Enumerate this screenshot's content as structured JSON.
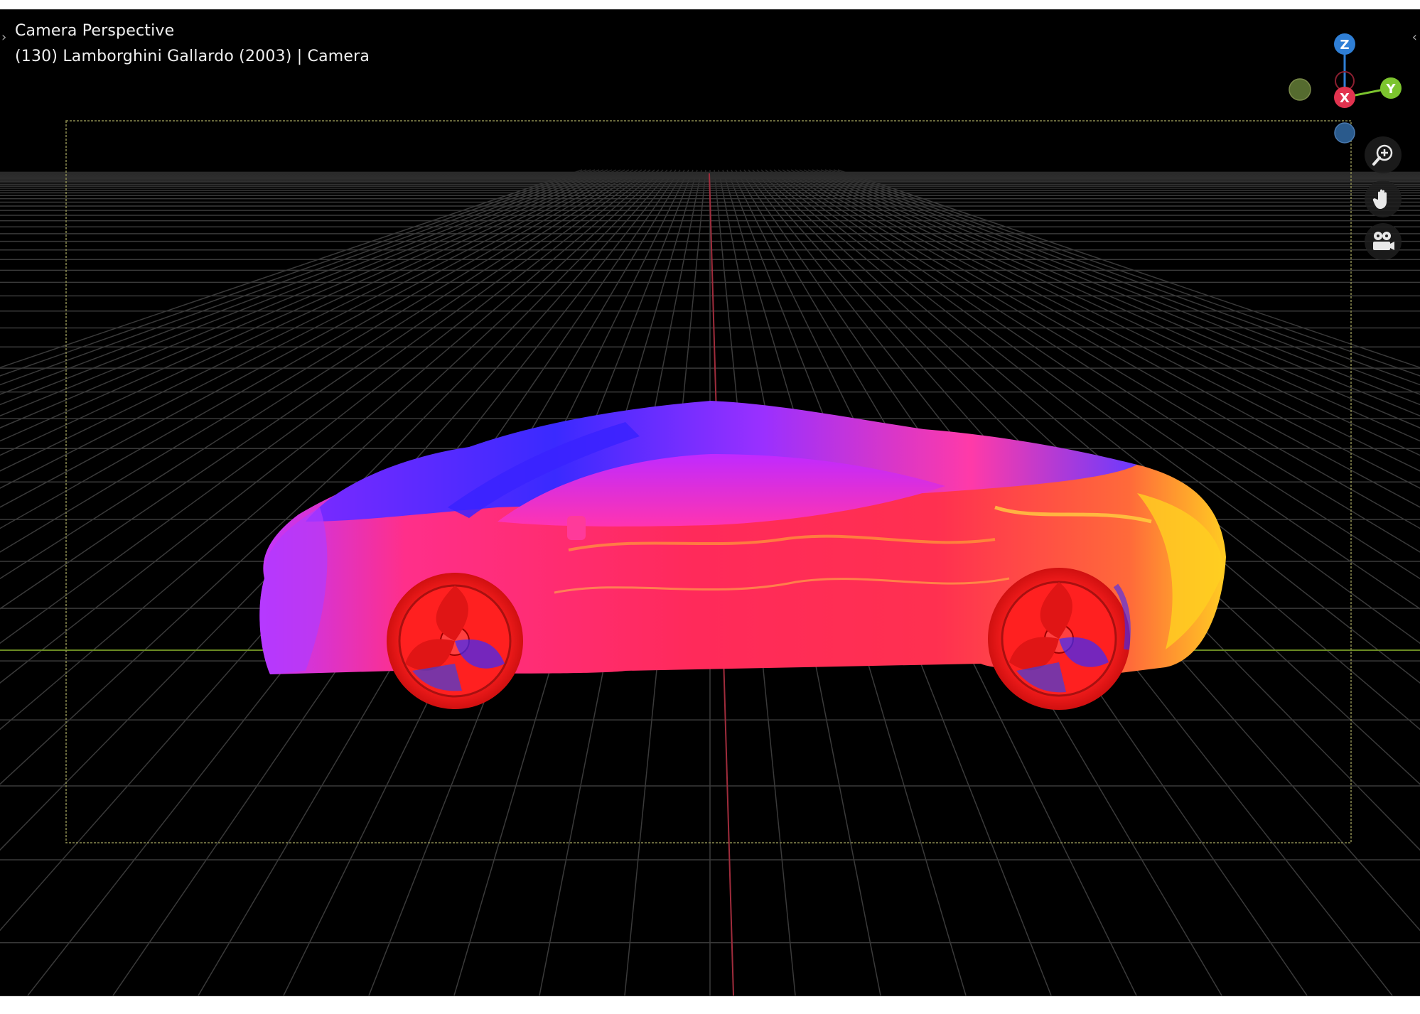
{
  "viewport": {
    "title": "Camera Perspective",
    "subtitle": "(130) Lamborghini Gallardo (2003) | Camera"
  },
  "gizmo": {
    "axes": [
      {
        "label": "Z",
        "color": "#2f7fd6"
      },
      {
        "label": "X",
        "color": "#e2334f"
      },
      {
        "label": "Y",
        "color": "#7cc42e"
      }
    ],
    "negative_axes": [
      {
        "name": "neg-y",
        "color": "#556b2f"
      },
      {
        "name": "neg-z",
        "color": "#2a5a8c"
      },
      {
        "name": "neg-x",
        "color": "#8a1f30"
      }
    ]
  },
  "nav_buttons": [
    {
      "name": "zoom-button",
      "icon": "zoom-icon"
    },
    {
      "name": "pan-button",
      "icon": "hand-icon"
    },
    {
      "name": "camera-view-button",
      "icon": "camera-icon"
    }
  ],
  "colors": {
    "background": "#000000",
    "grid": "#3a3a3a",
    "x_axis_line": "#7a9a2a",
    "y_axis_line": "#b03040",
    "camera_frame": "#9a9a5a",
    "car_primary": "#ff2a6a",
    "car_secondary": "#6a1aff"
  }
}
